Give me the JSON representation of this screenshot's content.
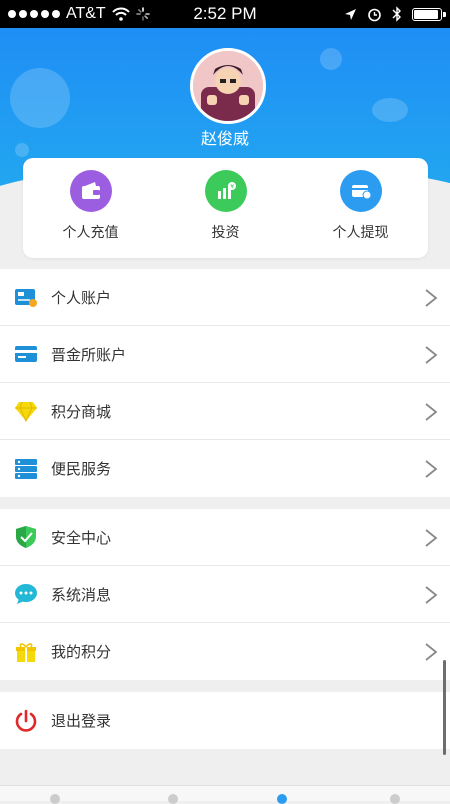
{
  "status_bar": {
    "carrier": "AT&T",
    "time": "2:52 PM",
    "battery_level": 0.85
  },
  "profile": {
    "name": "赵俊威"
  },
  "quick_actions": [
    {
      "label": "个人充值",
      "icon": "wallet-icon",
      "color": "#9b5ee0"
    },
    {
      "label": "投资",
      "icon": "bar-chart-icon",
      "color": "#3ccb5a"
    },
    {
      "label": "个人提现",
      "icon": "withdraw-card-icon",
      "color": "#2b9cf0"
    }
  ],
  "menu_group_1": [
    {
      "label": "个人账户",
      "icon": "account-card-icon"
    },
    {
      "label": "晋金所账户",
      "icon": "bank-card-icon"
    },
    {
      "label": "积分商城",
      "icon": "diamond-icon"
    },
    {
      "label": "便民服务",
      "icon": "service-list-icon"
    }
  ],
  "menu_group_2": [
    {
      "label": "安全中心",
      "icon": "shield-icon"
    },
    {
      "label": "系统消息",
      "icon": "message-bubble-icon"
    },
    {
      "label": "我的积分",
      "icon": "gift-icon"
    }
  ],
  "menu_group_3": [
    {
      "label": "退出登录",
      "icon": "power-icon"
    }
  ],
  "colors": {
    "header_blue": "#1f8ef5",
    "background": "#efefef",
    "logout_red": "#e02a2a"
  }
}
